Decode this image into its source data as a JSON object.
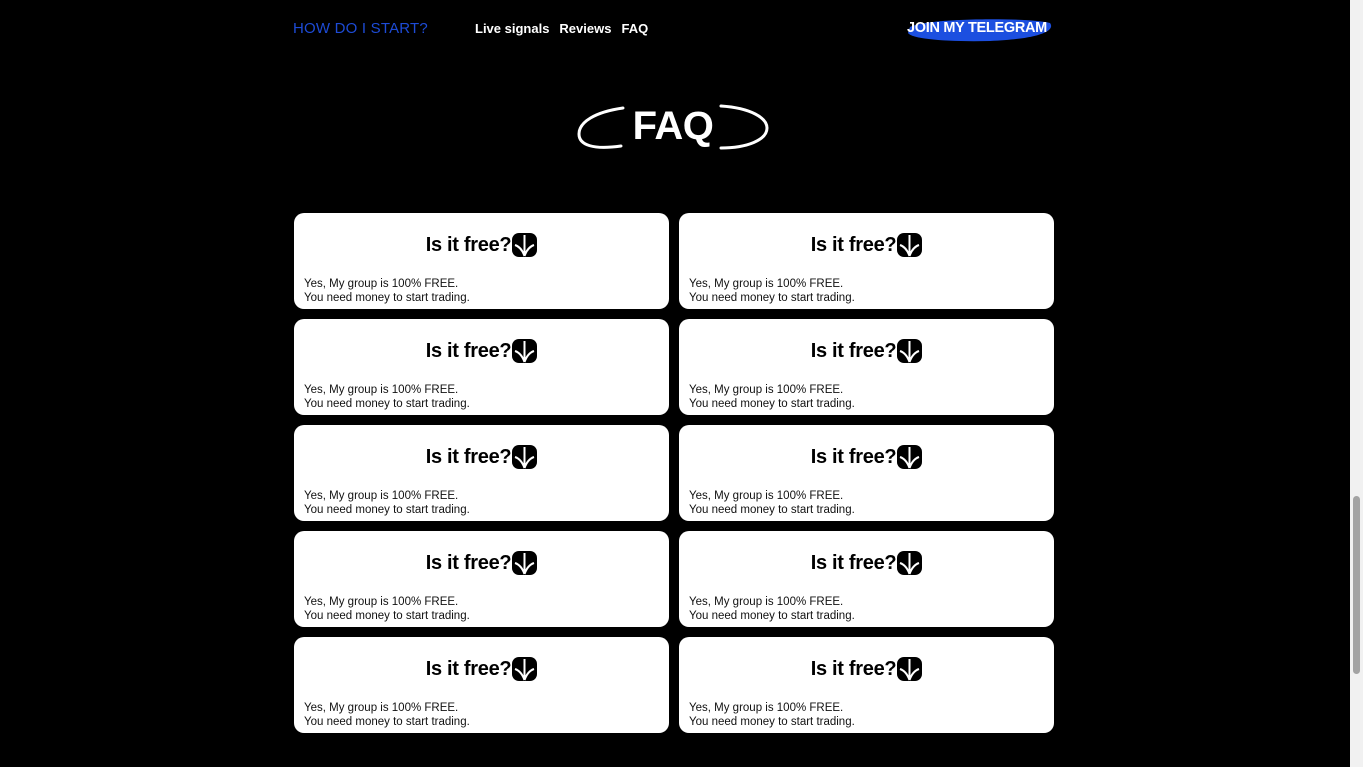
{
  "header": {
    "brand": "HOW DO I START?",
    "nav": [
      {
        "label": "Live signals"
      },
      {
        "label": "Reviews"
      },
      {
        "label": "FAQ"
      }
    ],
    "cta": "JOIN MY TELEGRAM"
  },
  "section": {
    "title": "FAQ"
  },
  "faq": [
    {
      "question": "Is it free?",
      "answer_line1": "Yes, My group is 100% FREE.",
      "answer_line2": "You need money to start trading."
    },
    {
      "question": "Is it free?",
      "answer_line1": "Yes, My group is 100% FREE.",
      "answer_line2": "You need money to start trading."
    },
    {
      "question": "Is it free?",
      "answer_line1": "Yes, My group is 100% FREE.",
      "answer_line2": "You need money to start trading."
    },
    {
      "question": "Is it free?",
      "answer_line1": "Yes, My group is 100% FREE.",
      "answer_line2": "You need money to start trading."
    },
    {
      "question": "Is it free?",
      "answer_line1": "Yes, My group is 100% FREE.",
      "answer_line2": "You need money to start trading."
    },
    {
      "question": "Is it free?",
      "answer_line1": "Yes, My group is 100% FREE.",
      "answer_line2": "You need money to start trading."
    },
    {
      "question": "Is it free?",
      "answer_line1": "Yes, My group is 100% FREE.",
      "answer_line2": "You need money to start trading."
    },
    {
      "question": "Is it free?",
      "answer_line1": "Yes, My group is 100% FREE.",
      "answer_line2": "You need money to start trading."
    },
    {
      "question": "Is it free?",
      "answer_line1": "Yes, My group is 100% FREE.",
      "answer_line2": "You need money to start trading."
    },
    {
      "question": "Is it free?",
      "answer_line1": "Yes, My group is 100% FREE.",
      "answer_line2": "You need money to start trading."
    }
  ],
  "colors": {
    "background": "#000000",
    "brand": "#1d4bd6",
    "cta_highlight": "#1c4fe0",
    "card": "#ffffff"
  },
  "icons": {
    "faq_toggle": "arrow-down-icon"
  }
}
